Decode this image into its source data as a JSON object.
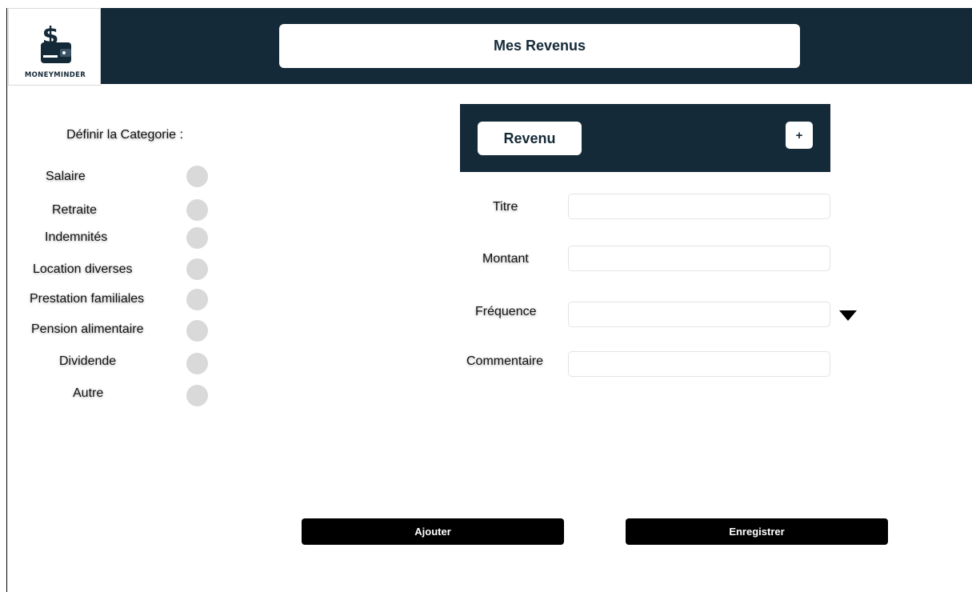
{
  "app": {
    "logo_text": "MONEYMINDER",
    "logo_icon": "money-wallet-icon",
    "title": "Mes Revenus"
  },
  "sidebar": {
    "heading": "Définir la Categorie :",
    "categories": [
      {
        "label": "Salaire"
      },
      {
        "label": "Retraite"
      },
      {
        "label": "Indemnités"
      },
      {
        "label": "Location diverses"
      },
      {
        "label": "Prestation familiales"
      },
      {
        "label": "Pension alimentaire"
      },
      {
        "label": "Dividende"
      },
      {
        "label": "Autre"
      }
    ]
  },
  "panel": {
    "tab_label": "Revenu",
    "add_label": "+"
  },
  "form": {
    "titre_label": "Titre",
    "titre_value": "",
    "montant_label": "Montant",
    "montant_value": "",
    "frequence_label": "Fréquence",
    "frequence_value": "",
    "commentaire_label": "Commentaire",
    "commentaire_value": ""
  },
  "actions": {
    "add_label": "Ajouter",
    "save_label": "Enregistrer"
  },
  "colors": {
    "navy": "#152a38",
    "radio_gray": "#d9d9d9",
    "button_black": "#000000"
  }
}
